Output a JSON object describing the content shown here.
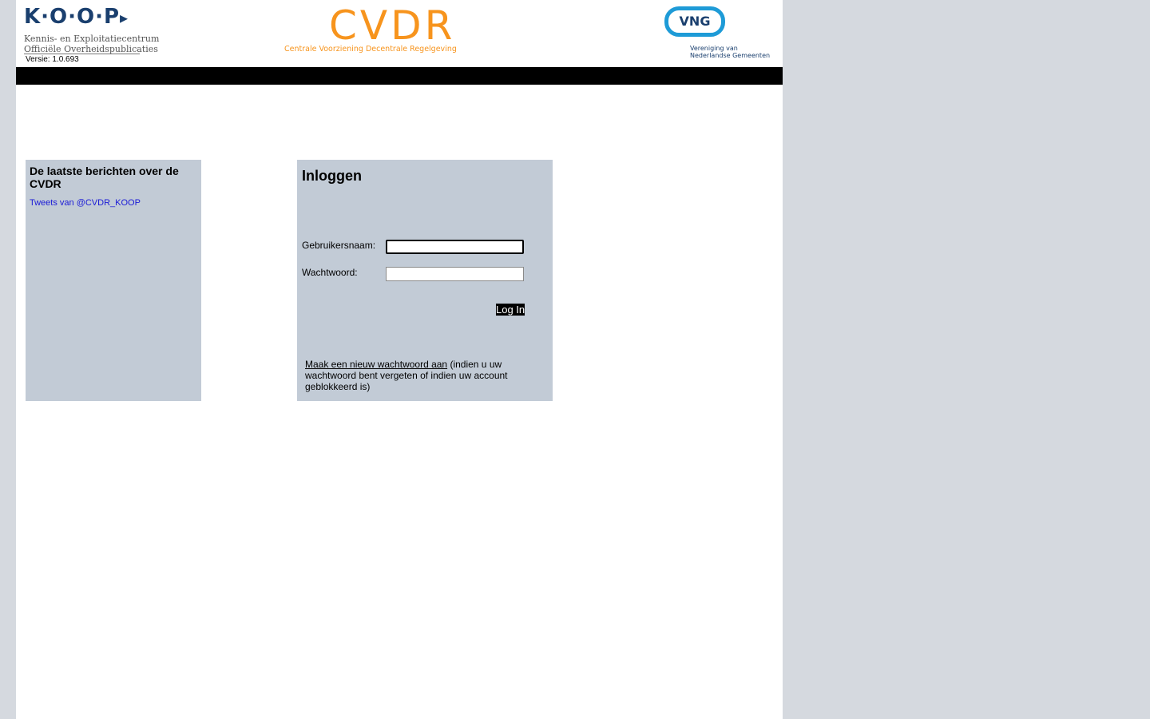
{
  "header": {
    "koop_logo": {
      "mark": "K·O·O·P",
      "line1": "Kennis- en Exploitatiecentrum",
      "line2": "Officiële Overheidspublicaties"
    },
    "version": "Versie: 1.0.693",
    "cvdr_logo": {
      "title": "CVDR",
      "subtitle": "Centrale Voorziening Decentrale Regelgeving"
    },
    "vng_logo": {
      "mark": "VNG",
      "line1": "Vereniging van",
      "line2": "Nederlandse Gemeenten"
    }
  },
  "news": {
    "title": "De laatste berichten over de CVDR",
    "tweets_link": "Tweets van @CVDR_KOOP"
  },
  "login": {
    "title": "Inloggen",
    "username_label": "Gebruikersnaam:",
    "username_value": "",
    "password_label": "Wachtwoord:",
    "password_value": "",
    "button_label": "Log In",
    "reset_link": "Maak een nieuw wachtwoord aan",
    "reset_note": "(indien u uw wachtwoord bent vergeten of indien uw account geblokkeerd is)"
  },
  "colors": {
    "background": "#d5d9df",
    "panel": "#c2cbd6",
    "cvdr_orange": "#f7941d",
    "vng_blue": "#1e9bd7",
    "koop_navy": "#1a3f6e",
    "nav_bar": "#000000"
  }
}
